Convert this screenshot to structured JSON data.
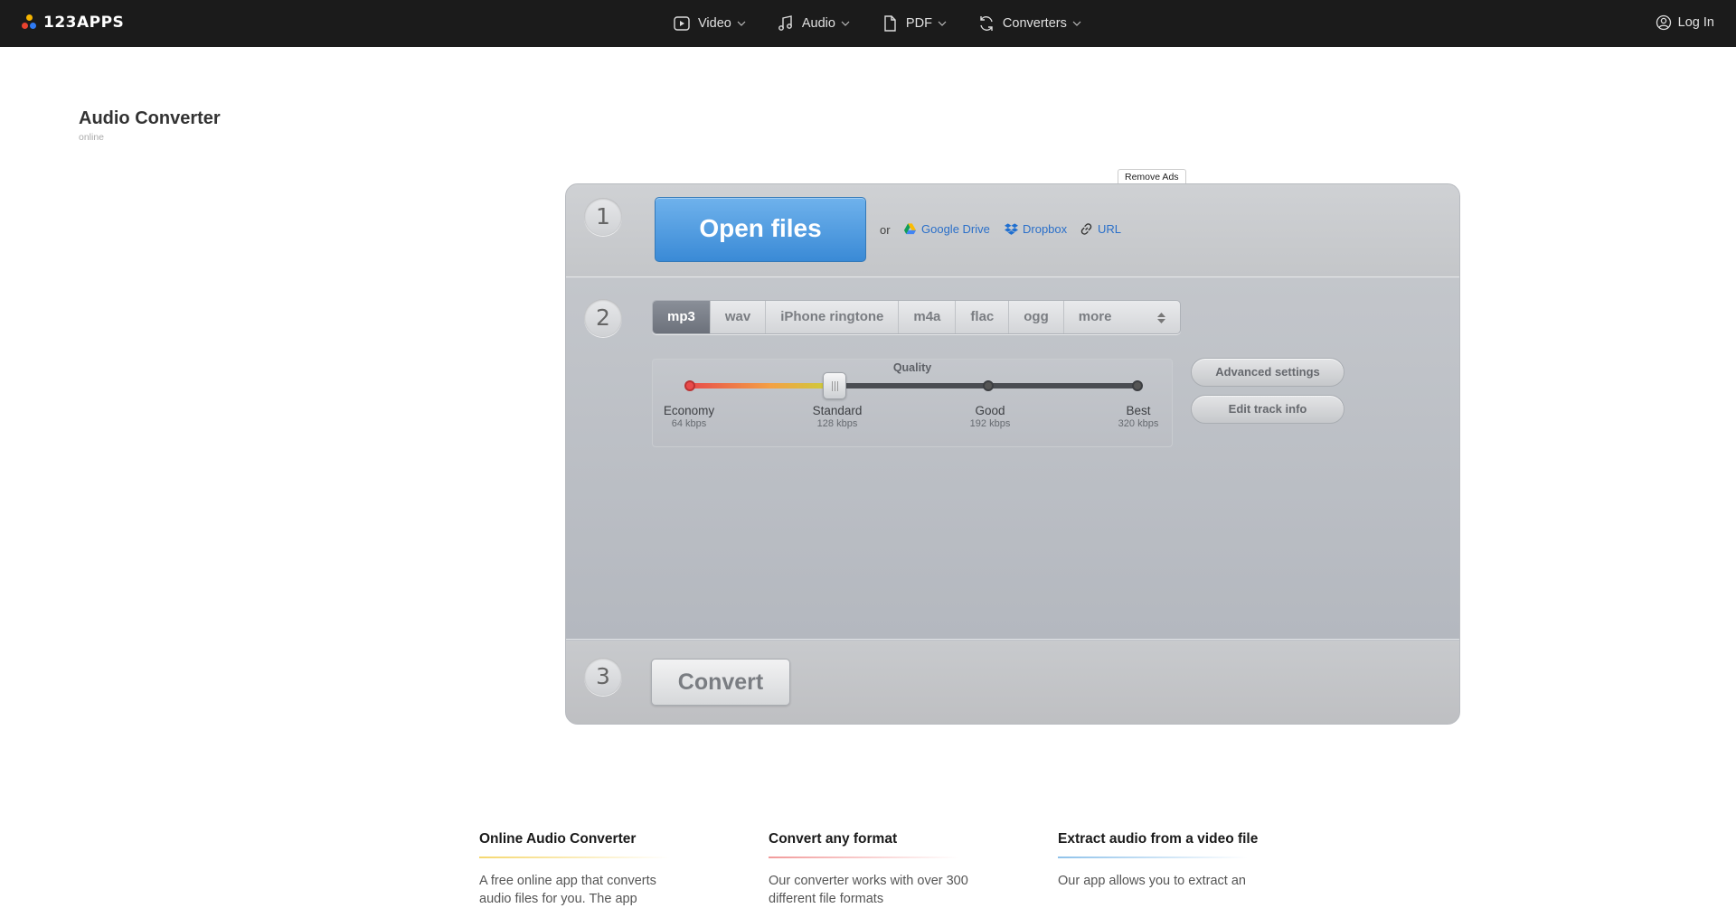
{
  "brand": {
    "name": "123APPS",
    "dot_colors": [
      "#f5b400",
      "#e8432e",
      "#2f7bf5"
    ]
  },
  "nav": {
    "items": [
      {
        "label": "Video",
        "icon": "video-icon"
      },
      {
        "label": "Audio",
        "icon": "music-note-icon"
      },
      {
        "label": "PDF",
        "icon": "document-icon"
      },
      {
        "label": "Converters",
        "icon": "refresh-icon"
      }
    ],
    "login_label": "Log In"
  },
  "page": {
    "title": "Audio Converter",
    "subtitle": "online"
  },
  "remove_ads_label": "Remove Ads",
  "step1": {
    "number": "1",
    "open_label": "Open files",
    "or_label": "or",
    "sources": [
      {
        "label": "Google Drive",
        "icon": "google-drive-icon"
      },
      {
        "label": "Dropbox",
        "icon": "dropbox-icon"
      },
      {
        "label": "URL",
        "icon": "link-icon"
      }
    ]
  },
  "step2": {
    "number": "2",
    "formats": [
      "mp3",
      "wav",
      "iPhone ringtone",
      "m4a",
      "flac",
      "ogg"
    ],
    "selected_format": "mp3",
    "more_label": "more",
    "quality": {
      "title": "Quality",
      "levels": [
        {
          "name": "Economy",
          "kbps": "64 kbps"
        },
        {
          "name": "Standard",
          "kbps": "128 kbps"
        },
        {
          "name": "Good",
          "kbps": "192 kbps"
        },
        {
          "name": "Best",
          "kbps": "320 kbps"
        }
      ],
      "selected_index": 1
    },
    "advanced_label": "Advanced settings",
    "track_info_label": "Edit track info"
  },
  "step3": {
    "number": "3",
    "convert_label": "Convert"
  },
  "features": [
    {
      "title": "Online Audio Converter",
      "text": "A free online app that converts audio files for you. The app",
      "accent": "#f5d76e"
    },
    {
      "title": "Convert any format",
      "text": "Our converter works with over 300 different file formats",
      "accent": "#f19a9a"
    },
    {
      "title": "Extract audio from a video file",
      "text": "Our app allows you to extract an",
      "accent": "#8fc2ea"
    }
  ]
}
